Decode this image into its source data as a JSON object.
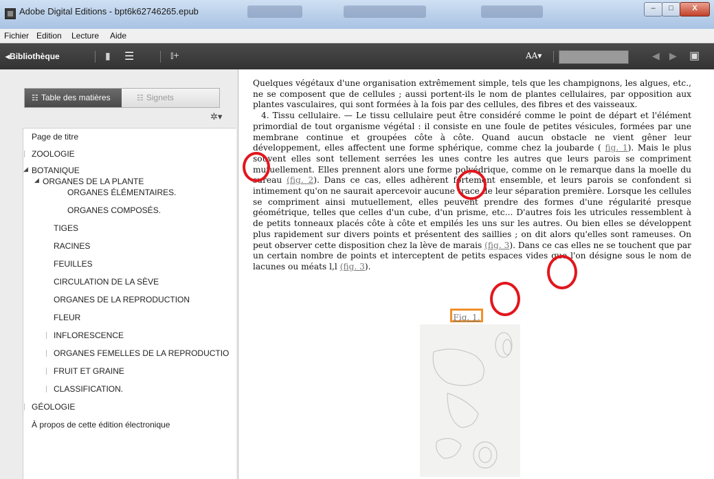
{
  "window": {
    "title": "Adobe Digital Editions - bpt6k62746265.epub",
    "buttons": {
      "minimize": "–",
      "maximize": "□",
      "close": "X"
    }
  },
  "menu": [
    "Fichier",
    "Edition",
    "Lecture",
    "Aide"
  ],
  "toolbar": {
    "library_label": "Bibliothèque",
    "font_size_label": "AA"
  },
  "sidebar": {
    "tabs": {
      "toc": "Table des matières",
      "bookmarks": "Signets"
    },
    "toc": [
      {
        "label": "Page de titre"
      },
      {
        "label": "ZOOLOGIE"
      },
      {
        "label": "BOTANIQUE"
      },
      {
        "label": "ORGANES DE LA PLANTE"
      },
      {
        "label": "ORGANES ÉLÉMENTAIRES."
      },
      {
        "label": "ORGANES COMPOSÉS."
      },
      {
        "label": "TIGES"
      },
      {
        "label": "RACINES"
      },
      {
        "label": "FEUILLES"
      },
      {
        "label": "CIRCULATION DE LA SÈVE"
      },
      {
        "label": "ORGANES DE LA REPRODUCTION"
      },
      {
        "label": "FLEUR"
      },
      {
        "label": "INFLORESCENCE"
      },
      {
        "label": "ORGANES FEMELLES DE LA REPRODUCTIO"
      },
      {
        "label": "FRUIT ET GRAINE"
      },
      {
        "label": "CLASSIFICATION."
      },
      {
        "label": "GÉOLOGIE"
      },
      {
        "label": "À propos de cette édition électronique"
      }
    ]
  },
  "content": {
    "p1": "Quelques végétaux d'une organisation extrêmement simple, tels que les champignons, les algues, etc., ne se composent que de cellules ; aussi portent-ils le nom de plantes cellulaires, par opposition aux plantes vasculaires, qui sont formées à la fois par des cellules, des fibres et des vaisseaux.",
    "p2_a": "4. Tissu cellulaire. — Le tissu cellulaire peut être considéré comme le point de départ et l'élément primordial de tout organisme végétal : il consiste en une foule de petites vésicules, formées par une membrane continue et groupées côte à côte. Quand aucun obstacle ne vient gêner leur développement, elles affectent une forme sphérique, comme chez la joubarde ( ",
    "link1": "fig. 1",
    "p2_b": "). Mais le plus souvent elles sont tellement serrées les unes contre les autres que leurs parois se compriment mutuellement. Elles prennent alors une forme polyédrique, comme on le remarque dans la moelle du sureau ",
    "link2": "(fig. 2",
    "p2_c": "). Dans ce cas, elles adhèrent fortement ensemble, et leurs parois se confondent si intimement qu'on ne saurait apercevoir aucune trace de leur séparation première. Lorsque les cellules se compriment ainsi mutuellement, elles peuvent prendre des formes d'une régularité presque géométrique, telles que celles d'un cube, d'un prisme, etc... D'autres fois les utricules ressemblent à de petits tonneaux placés côte à côte et empilés les uns sur les autres. Ou bien elles se développent plus rapidement sur divers points et présentent des saillies ; on dit alors qu'elles sont rameuses. On peut observer cette disposition chez la lève de marais ",
    "link3": "(fig. 3",
    "p2_d": "). Dans ce cas elles ne se touchent que par un certain nombre de points et interceptent de petits espaces vides que l'on désigne sous le nom de lacunes ou méats l,l ",
    "link4": "(fig. 3",
    "p2_e": ").",
    "figure_caption": "Fig. 1."
  },
  "colors": {
    "annotation_circle": "#e2161d",
    "figure_highlight": "#f08f2a"
  }
}
